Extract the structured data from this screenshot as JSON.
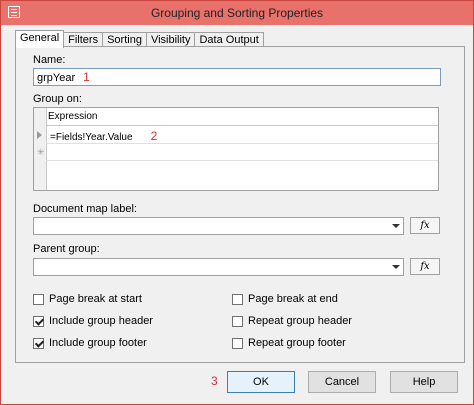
{
  "window": {
    "title": "Grouping and Sorting Properties"
  },
  "tabs": [
    {
      "label": "General"
    },
    {
      "label": "Filters"
    },
    {
      "label": "Sorting"
    },
    {
      "label": "Visibility"
    },
    {
      "label": "Data Output"
    }
  ],
  "general": {
    "name_label": "Name:",
    "name_value": "grpYear",
    "group_on_label": "Group on:",
    "grid_header": "Expression",
    "expressions": [
      "=Fields!Year.Value"
    ],
    "doc_map_label": "Document map label:",
    "doc_map_value": "",
    "parent_group_label": "Parent group:",
    "parent_group_value": "",
    "fx_label": "fx"
  },
  "checkboxes": {
    "page_break_start": {
      "label": "Page break at start",
      "checked": false
    },
    "include_header": {
      "label": "Include group header",
      "checked": true
    },
    "include_footer": {
      "label": "Include group footer",
      "checked": true
    },
    "page_break_end": {
      "label": "Page break at end",
      "checked": false
    },
    "repeat_header": {
      "label": "Repeat group header",
      "checked": false
    },
    "repeat_footer": {
      "label": "Repeat group footer",
      "checked": false
    }
  },
  "annotations": {
    "n1": "1",
    "n2": "2",
    "n3": "3"
  },
  "buttons": {
    "ok": "OK",
    "cancel": "Cancel",
    "help": "Help"
  },
  "colors": {
    "titlebar": "#e8716c",
    "annotation": "#d03030"
  }
}
